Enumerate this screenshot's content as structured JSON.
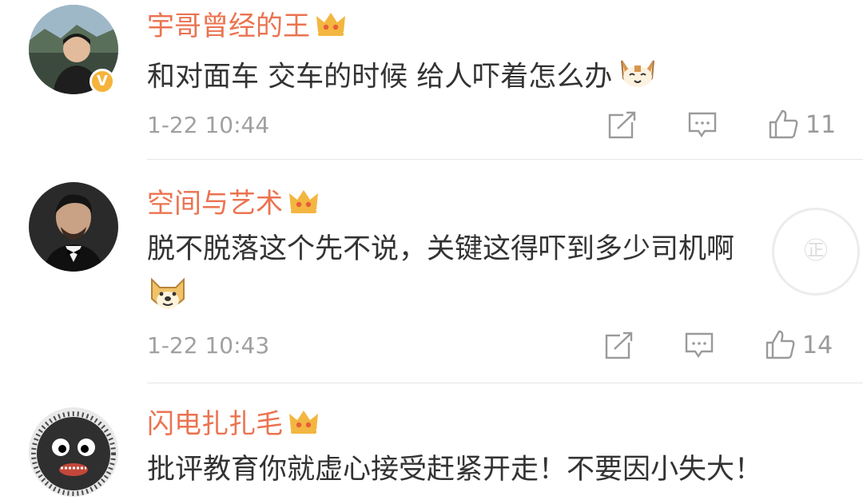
{
  "comments": [
    {
      "username": "宇哥曾经的王",
      "text": "和对面车 交车的时候 给人吓着怎么办",
      "emoji": "cat-face",
      "time": "1-22 10:44",
      "likes": "11",
      "verified": true,
      "verified_mark": "V"
    },
    {
      "username": "空间与艺术",
      "text": "脱不脱落这个先不说，关键这得吓到多少司机啊",
      "emoji": "doge-face",
      "time": "1-22 10:43",
      "likes": "14"
    },
    {
      "username": "闪电扎扎毛",
      "text": "批评教育你就虚心接受赶紧开走！不要因小失大！"
    }
  ],
  "colors": {
    "username": "#eb7350",
    "text": "#333333",
    "meta": "#a0a0a0",
    "crown": "#f3b640"
  },
  "icons": [
    "crown-badge-icon",
    "share-icon",
    "comment-icon",
    "like-icon",
    "verified-badge-icon"
  ]
}
